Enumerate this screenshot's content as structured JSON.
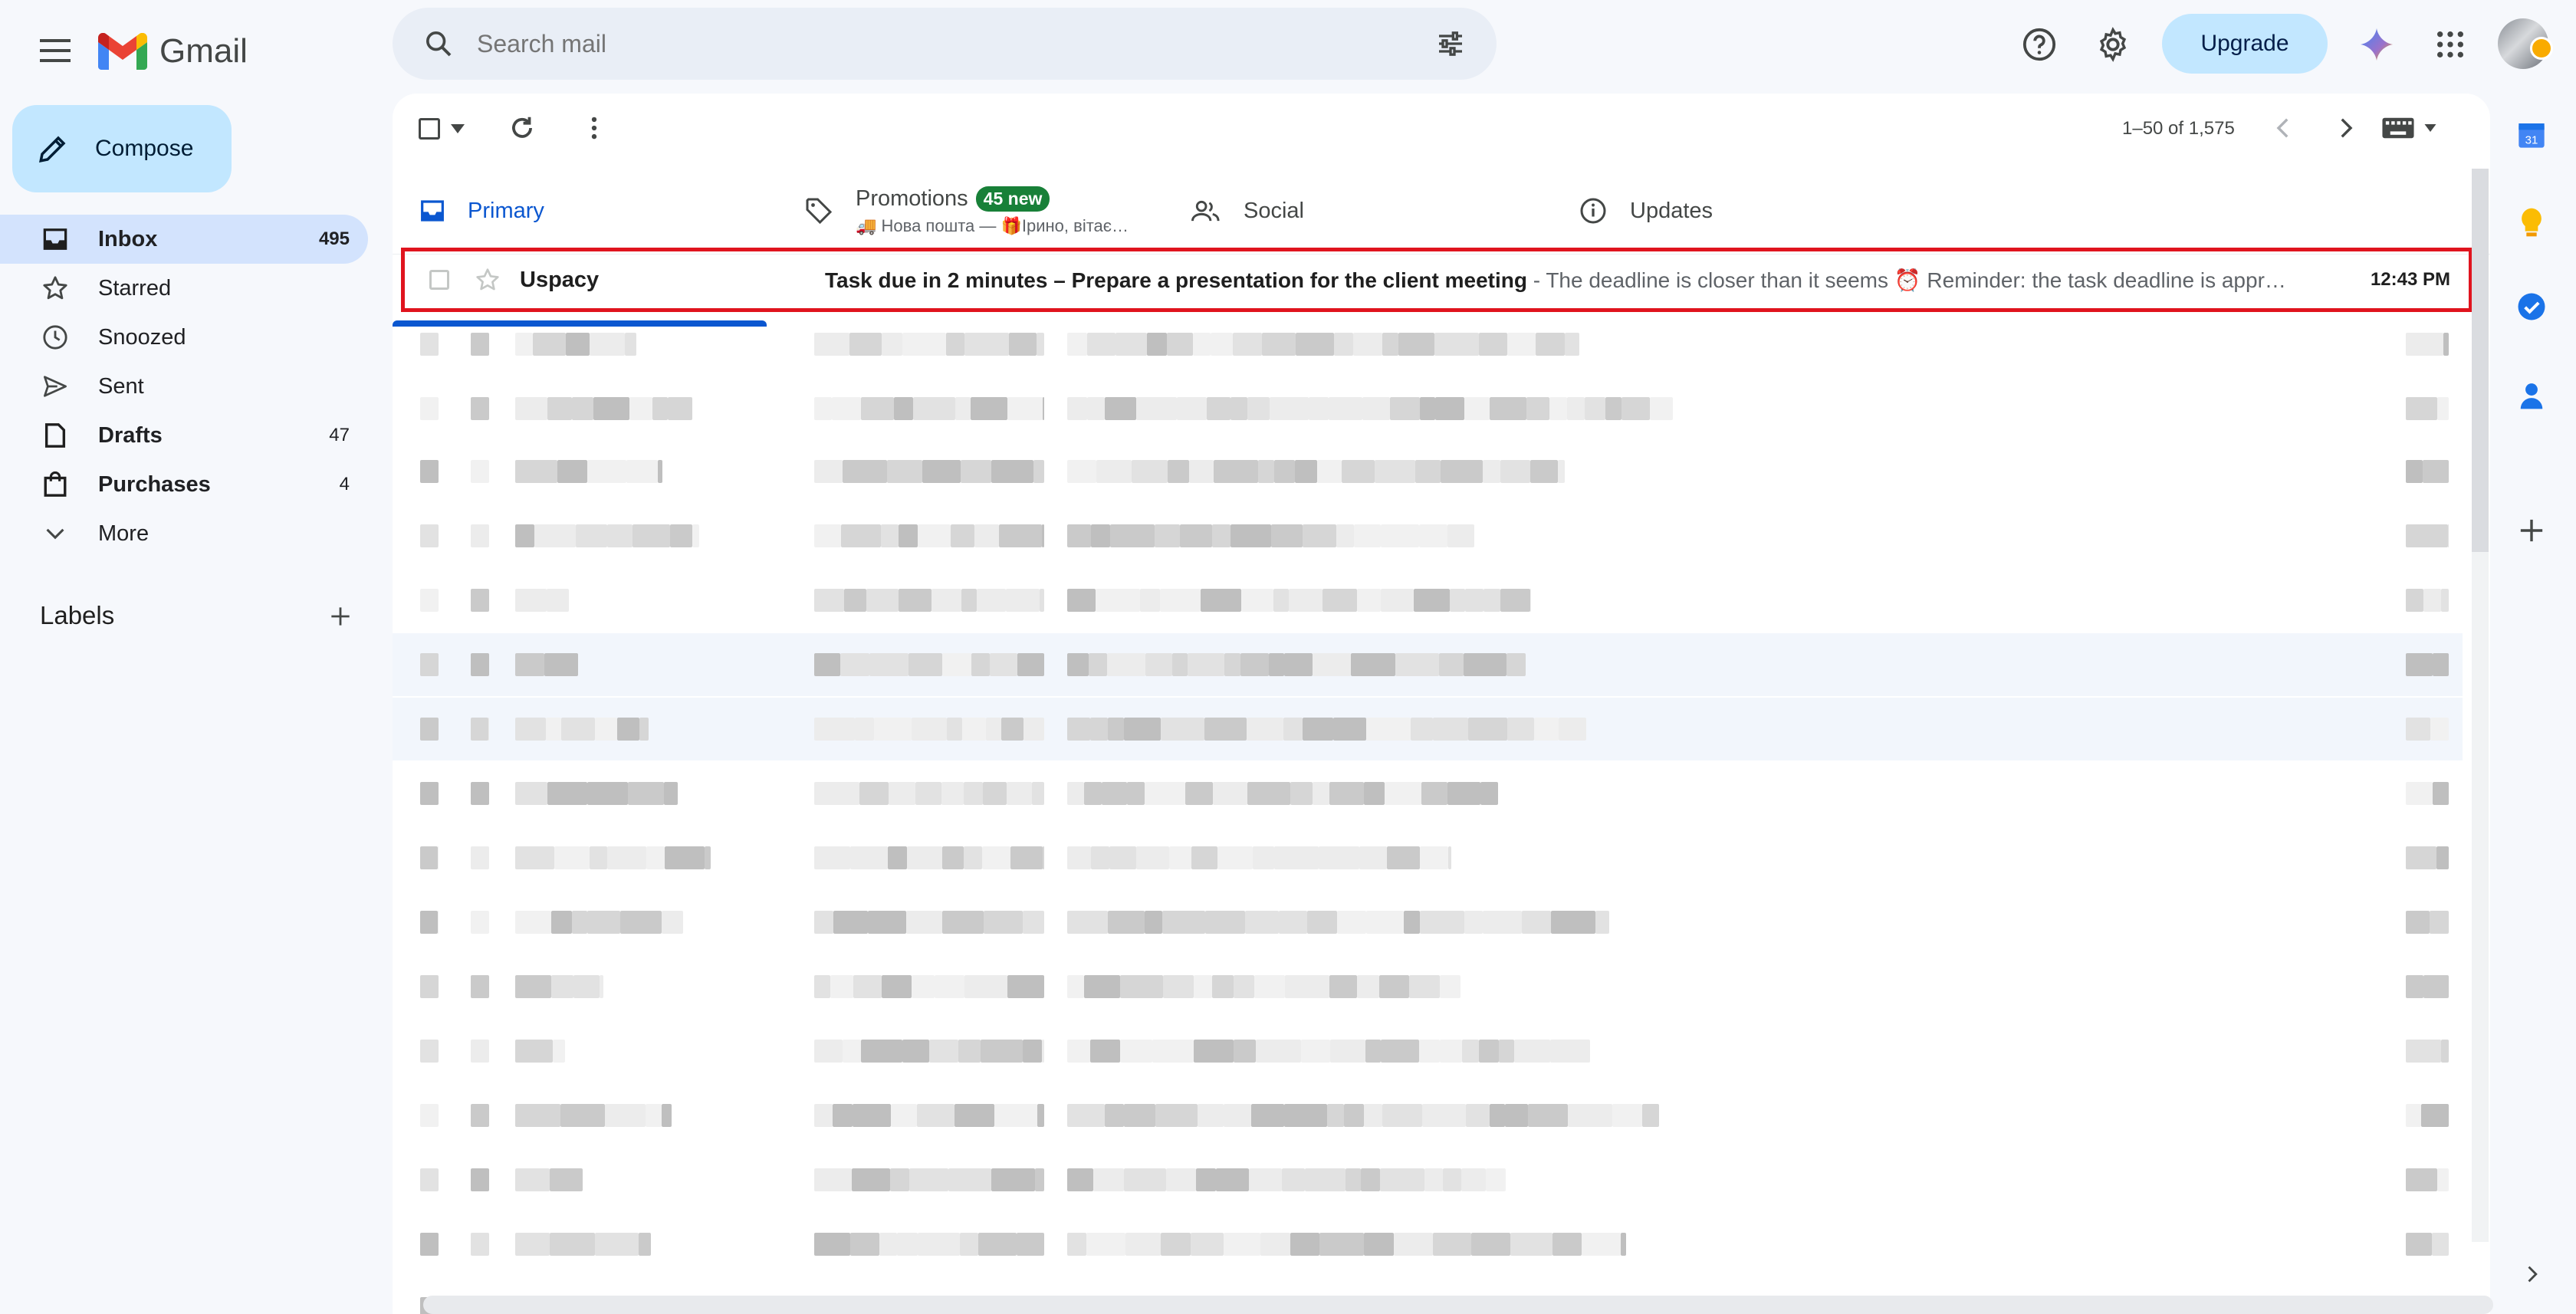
{
  "app": {
    "name": "Gmail"
  },
  "search": {
    "placeholder": "Search mail"
  },
  "header": {
    "upgrade_label": "Upgrade"
  },
  "compose": {
    "label": "Compose"
  },
  "nav": {
    "items": [
      {
        "label": "Inbox",
        "count": "495",
        "icon": "inbox-icon"
      },
      {
        "label": "Starred",
        "count": "",
        "icon": "star-icon"
      },
      {
        "label": "Snoozed",
        "count": "",
        "icon": "clock-icon"
      },
      {
        "label": "Sent",
        "count": "",
        "icon": "send-icon"
      },
      {
        "label": "Drafts",
        "count": "47",
        "icon": "draft-icon"
      },
      {
        "label": "Purchases",
        "count": "4",
        "icon": "shopping-bag-icon"
      },
      {
        "label": "More",
        "count": "",
        "icon": "chevron-down-icon"
      }
    ]
  },
  "labels": {
    "heading": "Labels"
  },
  "toolbar": {
    "pagination": "1–50 of 1,575"
  },
  "tabs": [
    {
      "label": "Primary",
      "icon": "inbox-icon"
    },
    {
      "label": "Promotions",
      "icon": "tag-icon",
      "badge": "45 new",
      "snippet": "🚚 Нова пошта — 🎁Ірино, вітає…"
    },
    {
      "label": "Social",
      "icon": "people-icon"
    },
    {
      "label": "Updates",
      "icon": "info-icon"
    }
  ],
  "emails": [
    {
      "sender": "Uspacy",
      "subject": "Task due in 2 minutes – Prepare a presentation for the client meeting",
      "snippet": " - The deadline is closer than it seems ⏰ Reminder: the task deadline is appr…",
      "time": "12:43 PM",
      "highlighted": true
    }
  ],
  "colors": {
    "accent": "#0b57d0",
    "compose_bg": "#c2e7ff",
    "active_nav_bg": "#d3e3fd",
    "badge_green": "#188038",
    "highlight_red": "#e0141e"
  }
}
